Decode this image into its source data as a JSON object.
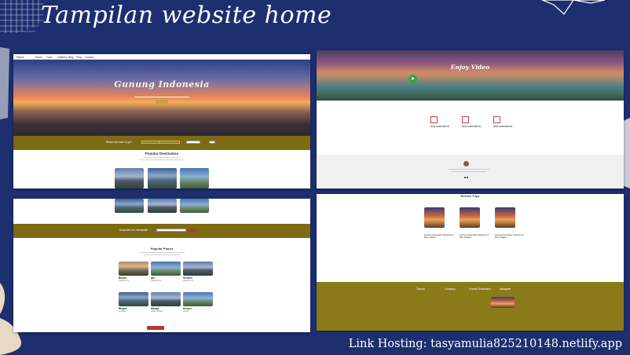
{
  "slide": {
    "title": "Tampilan website home",
    "link_hosting": "Link Hosting: tasyamulia825210148.netlify.app",
    "colors": {
      "background": "#1d2f6f",
      "accent_olive": "#7d6a12",
      "play_green": "#2aa84a",
      "button_red": "#b23b2b"
    }
  },
  "panel1": {
    "logo": "Travela",
    "nav_links": [
      "Home",
      "Tours",
      "Galleries",
      "Blog",
      "Shop",
      "Contact"
    ],
    "hero_title": "Gunung Indonesia",
    "search_label": "Where you want to go?",
    "section_title": "Popular Destination"
  },
  "panel2": {
    "hero_title": "Enjoy Video",
    "features": [
      "Best destinations",
      "Best destinations",
      "Best destinations"
    ]
  },
  "panel4": {
    "section_title": "Recent Trips",
    "trips": [
      "Famous Destination Maryland to Best Villages",
      "Famous Destination Maryland to Best Villages",
      "Famous Destination Maryland to Best Villages"
    ],
    "footer_logo": "Travela",
    "footer_headings": [
      "Company",
      "Popular Destination",
      "Instagram"
    ]
  },
  "panel3": {
    "banner_text": "Subscribe Our Newsletter",
    "section_title": "Popular Places",
    "places": [
      {
        "name": "Bromo",
        "sub": "Jawa Timur"
      },
      {
        "name": "Ijen",
        "sub": "Jawa Timur"
      },
      {
        "name": "Semeru",
        "sub": "Jawa Timur"
      },
      {
        "name": "Rinjani",
        "sub": "Lombok"
      },
      {
        "name": "Merapi",
        "sub": "Jawa Tengah"
      },
      {
        "name": "Kerinci",
        "sub": "Jambi"
      }
    ]
  }
}
